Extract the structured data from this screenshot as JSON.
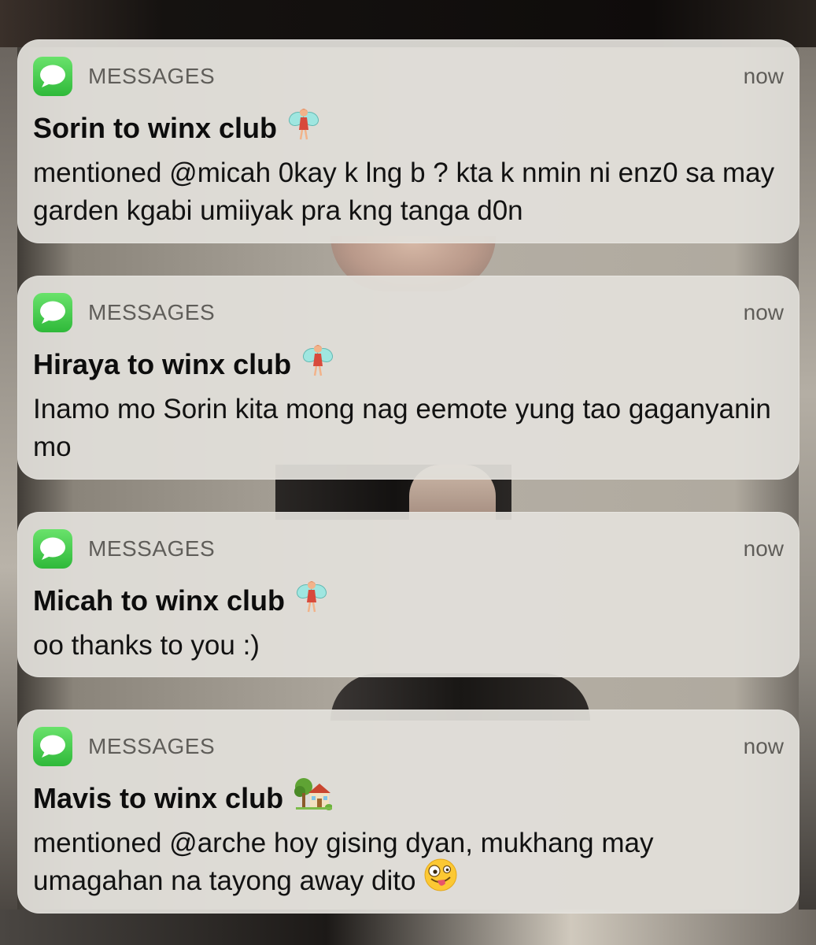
{
  "notifications": [
    {
      "app": "MESSAGES",
      "app_icon": "messages-bubble-icon",
      "time": "now",
      "title": "Sorin to winx club",
      "title_emoji": "fairy-icon",
      "body": "mentioned @micah 0kay k lng b ? kta k nmin ni enz0 sa may garden kgabi umiiyak pra kng tanga d0n"
    },
    {
      "app": "MESSAGES",
      "app_icon": "messages-bubble-icon",
      "time": "now",
      "title": "Hiraya to winx club",
      "title_emoji": "fairy-icon",
      "body": "Inamo mo Sorin kita mong nag eemote yung tao gaganyanin mo"
    },
    {
      "app": "MESSAGES",
      "app_icon": "messages-bubble-icon",
      "time": "now",
      "title": "Micah to winx club",
      "title_emoji": "fairy-icon",
      "body": "oo thanks to you :)"
    },
    {
      "app": "MESSAGES",
      "app_icon": "messages-bubble-icon",
      "time": "now",
      "title": "Mavis to winx club",
      "title_emoji": "house-with-garden-icon",
      "body": "mentioned @arche hoy gising dyan, mukhang may umagahan na tayong away dito",
      "body_emoji": "zany-face-icon"
    }
  ],
  "colors": {
    "card_background": "#e2e0da",
    "app_icon_green": "#3fc84a",
    "meta_text": "#5f5d59",
    "title_text": "#0d0d0d"
  }
}
